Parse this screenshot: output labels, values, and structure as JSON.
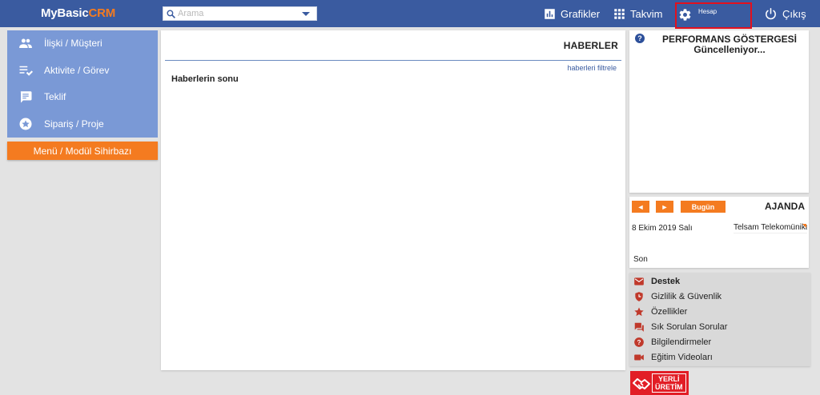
{
  "brand": {
    "part1": "MyBasic",
    "part2": "CRM"
  },
  "search": {
    "placeholder": "Arama",
    "value": ""
  },
  "topnav": {
    "grafikler": "Grafikler",
    "takvim": "Takvim",
    "hesap": "Hesap",
    "cikis": "Çıkış"
  },
  "sidebar": {
    "items": [
      {
        "label": "İlişki / Müşteri",
        "icon": "people-icon"
      },
      {
        "label": "Aktivite / Görev",
        "icon": "task-list-icon"
      },
      {
        "label": "Teklif",
        "icon": "message-icon"
      },
      {
        "label": "Sipariş / Proje",
        "icon": "star-circle-icon"
      }
    ],
    "wizard_label": "Menü / Modül Sihirbazı"
  },
  "news": {
    "title": "HABERLER",
    "filter_link": "haberleri filtrele",
    "end_text": "Haberlerin sonu"
  },
  "performance": {
    "help": "?",
    "line1": "PERFORMANS GÖSTERGESİ",
    "line2": "Güncelleniyor..."
  },
  "agenda": {
    "prev": "◄",
    "next": "►",
    "today": "Bugün",
    "title": "AJANDA",
    "date": "8 Ekim 2019 Salı",
    "event": "Telsam Telekomünikasyon",
    "end": "Son"
  },
  "support": {
    "items": [
      {
        "label": "Destek",
        "icon": "mail-icon",
        "bold": true
      },
      {
        "label": "Gizlilik & Güvenlik",
        "icon": "shield-icon"
      },
      {
        "label": "Özellikler",
        "icon": "star-icon"
      },
      {
        "label": "Sık Sorulan Sorular",
        "icon": "chat-icon"
      },
      {
        "label": "Bilgilendirmeler",
        "icon": "help-circle-icon"
      },
      {
        "label": "Eğitim Videoları",
        "icon": "video-camera-icon"
      }
    ]
  },
  "badge": {
    "line1": "YERLİ",
    "line2": "ÜRETİM"
  },
  "colors": {
    "topbar": "#3a5ba0",
    "sidebar": "#7a99d6",
    "accent": "#f47b20",
    "highlight": "#e3101d"
  }
}
